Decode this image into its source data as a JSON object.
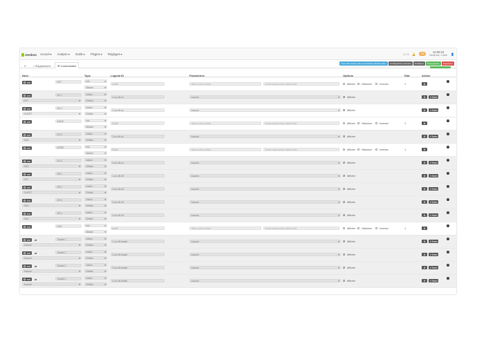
{
  "navbar": {
    "logo": "Jeedom",
    "menu": [
      "Accueil ▾",
      "Analyse ▾",
      "Outils ▾",
      "Plugins ▾",
      "Réglages ▾"
    ],
    "ratio": "1 / 1",
    "badge": "138",
    "time": "12:00:34",
    "date": "Vendredi, 1 Avril"
  },
  "tabs": {
    "back_icon": "↩",
    "equipment": "Équipement",
    "commands": "Commandes"
  },
  "actions": [
    {
      "label": "Avec dimensions des commandes d'information",
      "color": "blue"
    },
    {
      "label": "Configuration avancée",
      "color": "gray"
    },
    {
      "label": "Dupliquer",
      "color": "gray"
    },
    {
      "label": "Sauvegarder",
      "color": "green"
    },
    {
      "label": "Supprimer",
      "color": "red"
    }
  ],
  "headers": {
    "nom": "Nom",
    "type": "Type",
    "logical": "Logical ID",
    "params": "Paramètres",
    "options": "Options",
    "etat": "Etat",
    "action": "Action"
  },
  "common": {
    "voir": "voir",
    "type_info": "info",
    "type_action": "Action",
    "sub_binary": "Binaire",
    "sub_default": "Défaut",
    "value_ph": "Valeur retour d'état",
    "delay_ph": "Durée avant retour d'état (min)",
    "aucune": "Aucune",
    "afficher": "Afficher",
    "historiser": "Historiser",
    "inverser": "Inverser",
    "tester": "Tester",
    "gear": "⚙",
    "minus": "−"
  },
  "rows": [
    {
      "kind": "info",
      "name": "EST",
      "logical": "1-4-9",
      "etat": "1"
    },
    {
      "kind": "action",
      "name": "On 1",
      "parent": "EST",
      "logical": "1-on,off-on"
    },
    {
      "kind": "info",
      "name": "On 2",
      "logical": "2-on,off-on",
      "kind2": "action",
      "parent": "OUEST"
    },
    {
      "kind": "info",
      "name": "SUDE",
      "logical": "2-4-9",
      "etat": "1"
    },
    {
      "kind": "action",
      "name": "On 3",
      "parent": "SUD",
      "logical": "3-on,off-on"
    },
    {
      "kind": "info",
      "name": "NORD",
      "logical": "3-4-9",
      "etat": "1"
    },
    {
      "kind": "action",
      "name": "On 4",
      "parent": "SUD",
      "logical": "4-on,off-on"
    },
    {
      "kind": "action",
      "name": "Off 1",
      "parent": "EST",
      "logical": "1-on,off-off"
    },
    {
      "kind": "action",
      "name": "Off 2",
      "parent": "OUEST",
      "logical": "2-on,off-off"
    },
    {
      "kind": "action",
      "name": "Off 3",
      "parent": "SUD",
      "logical": "3-on,off-off"
    },
    {
      "kind": "action",
      "name": "Off 4",
      "parent": "SUD",
      "logical": "4-on,off-off"
    },
    {
      "kind": "info",
      "name": "SUD",
      "logical": "4-4-9",
      "etat": "1"
    },
    {
      "kind": "toggle",
      "name": "Toggle 1",
      "parent": "Aucune",
      "logical": "1-on,off-toggle"
    },
    {
      "kind": "toggle",
      "name": "Toggle 2",
      "parent": "Aucune",
      "logical": "2-on,off-toggle"
    },
    {
      "kind": "toggle",
      "name": "Toggle 3",
      "parent": "Aucune",
      "logical": "3-on,off-toggle"
    },
    {
      "kind": "toggle",
      "name": "Toggle 4",
      "parent": "Aucune",
      "logical": "4-on,off-toggle"
    }
  ],
  "colors": {
    "accent": "#94ca02",
    "dark_button": "#555555",
    "blue": "#4baadc",
    "green": "#5cb85c",
    "red": "#d9534f"
  }
}
